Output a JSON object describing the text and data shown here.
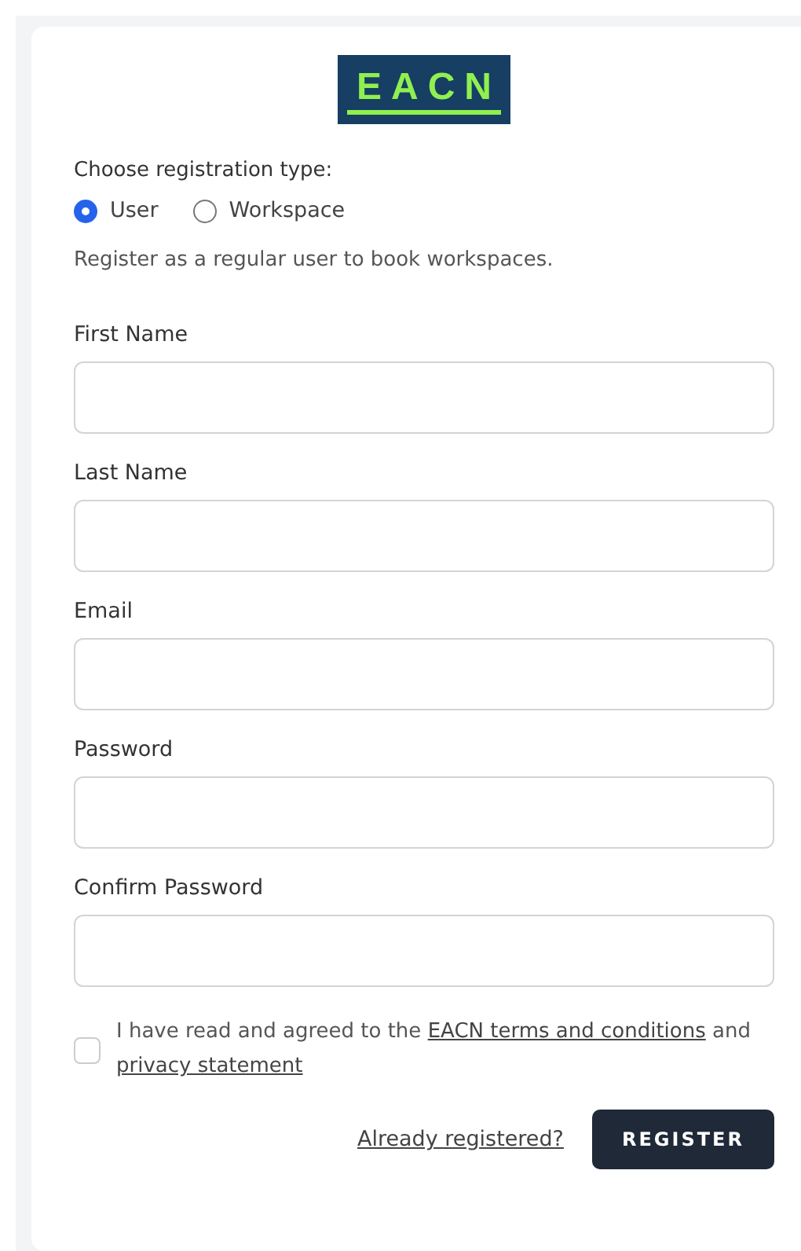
{
  "logo": {
    "text": "EACN"
  },
  "registration_type": {
    "label": "Choose registration type:",
    "options": [
      {
        "label": "User",
        "selected": true
      },
      {
        "label": "Workspace",
        "selected": false
      }
    ],
    "description": "Register as a regular user to book workspaces."
  },
  "fields": [
    {
      "label": "First Name"
    },
    {
      "label": "Last Name"
    },
    {
      "label": "Email"
    },
    {
      "label": "Password"
    },
    {
      "label": "Confirm Password"
    }
  ],
  "consent": {
    "checked": false,
    "text_before": "I have read and agreed to the",
    "terms_link": "EACN terms and conditions",
    "text_middle": "and",
    "privacy_link": "privacy statement"
  },
  "login_link": "Already registered?",
  "register_button": "REGISTER"
}
